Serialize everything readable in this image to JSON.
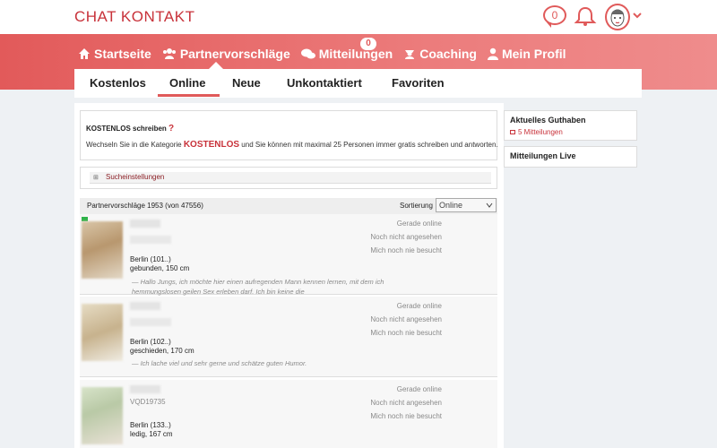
{
  "header": {
    "logo": "CHAT KONTAKT",
    "chat_count": "0",
    "icons": [
      "chat-bubble-icon",
      "bell-icon",
      "avatar",
      "chevron-down-icon"
    ]
  },
  "mainnav": {
    "items": [
      {
        "label": "Startseite",
        "icon": "home-icon"
      },
      {
        "label": "Partnervorschläge",
        "icon": "users-icon"
      },
      {
        "label": "Mitteilungen",
        "icon": "comments-icon",
        "badge": "0"
      },
      {
        "label": "Coaching",
        "icon": "coach-icon"
      },
      {
        "label": "Mein Profil",
        "icon": "user-icon"
      }
    ]
  },
  "subtabs": {
    "items": [
      "Kostenlos",
      "Online",
      "Neue",
      "Unkontaktiert",
      "Favoriten"
    ],
    "active": "Online"
  },
  "info": {
    "title": "KOSTENLOS schreiben",
    "q": "?",
    "text_pre": "Wechseln Sie in die Kategorie",
    "highlight": "KOSTENLOS",
    "text_post": "und Sie können mit maximal 25 Personen immer gratis schreiben und antworten."
  },
  "search": {
    "plus": "⊞",
    "label": "Sucheinstellungen"
  },
  "list": {
    "count_text": "Partnervorschläge 1953 (von 47556)",
    "sort_label": "Sortierung",
    "sort_value": "Online"
  },
  "profiles": [
    {
      "city": "Berlin (101..)",
      "status": "gebunden, 150 cm",
      "quote": "—   Hallo Jungs, ich möchte hier einen aufregenden Mann kennen lernen, mit dem ich hemmungslosen geilen Sex erleben darf. Ich bin keine die",
      "online": "Gerade online",
      "seen": "Noch nicht angesehen",
      "visited": "Mich noch nie besucht"
    },
    {
      "city": "Berlin (102..)",
      "status": "geschieden, 170 cm",
      "quote": "—   Ich lache viel und sehr gerne und schätze guten Humor.",
      "online": "Gerade online",
      "seen": "Noch nicht angesehen",
      "visited": "Mich noch nie besucht"
    },
    {
      "city": "Berlin (133..)",
      "status": "ledig, 167 cm",
      "id_fragment": "VQD19735",
      "quote": "",
      "online": "Gerade online",
      "seen": "Noch nicht angesehen",
      "visited": "Mich noch nie besucht"
    }
  ],
  "sidebar": {
    "guthaben_title": "Aktuelles Guthaben",
    "guthaben_value": "5 Mitteilungen",
    "live_title": "Mitteilungen Live"
  },
  "colors": {
    "brand": "#c8323a",
    "nav_red": "#e25a5a",
    "online_green": "#2fb34a"
  }
}
